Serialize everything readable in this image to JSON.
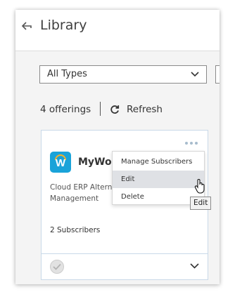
{
  "header": {
    "title": "Library"
  },
  "filter": {
    "selected": "All Types"
  },
  "toolbar": {
    "count": "4 offerings",
    "refresh_label": "Refresh"
  },
  "card": {
    "name": "MyWorkday",
    "name_visible": "MyWor",
    "description_line1": "Cloud ERP Alternat",
    "description_line2": "Management",
    "subscribers": "2 Subscribers",
    "icon_color": "#1aa3d9",
    "icon_letter": "W"
  },
  "menu": {
    "items": [
      {
        "label": "Manage Subscribers"
      },
      {
        "label": "Edit",
        "hovered": true
      },
      {
        "label": "Delete"
      }
    ]
  },
  "tooltip": {
    "text": "Edit"
  }
}
